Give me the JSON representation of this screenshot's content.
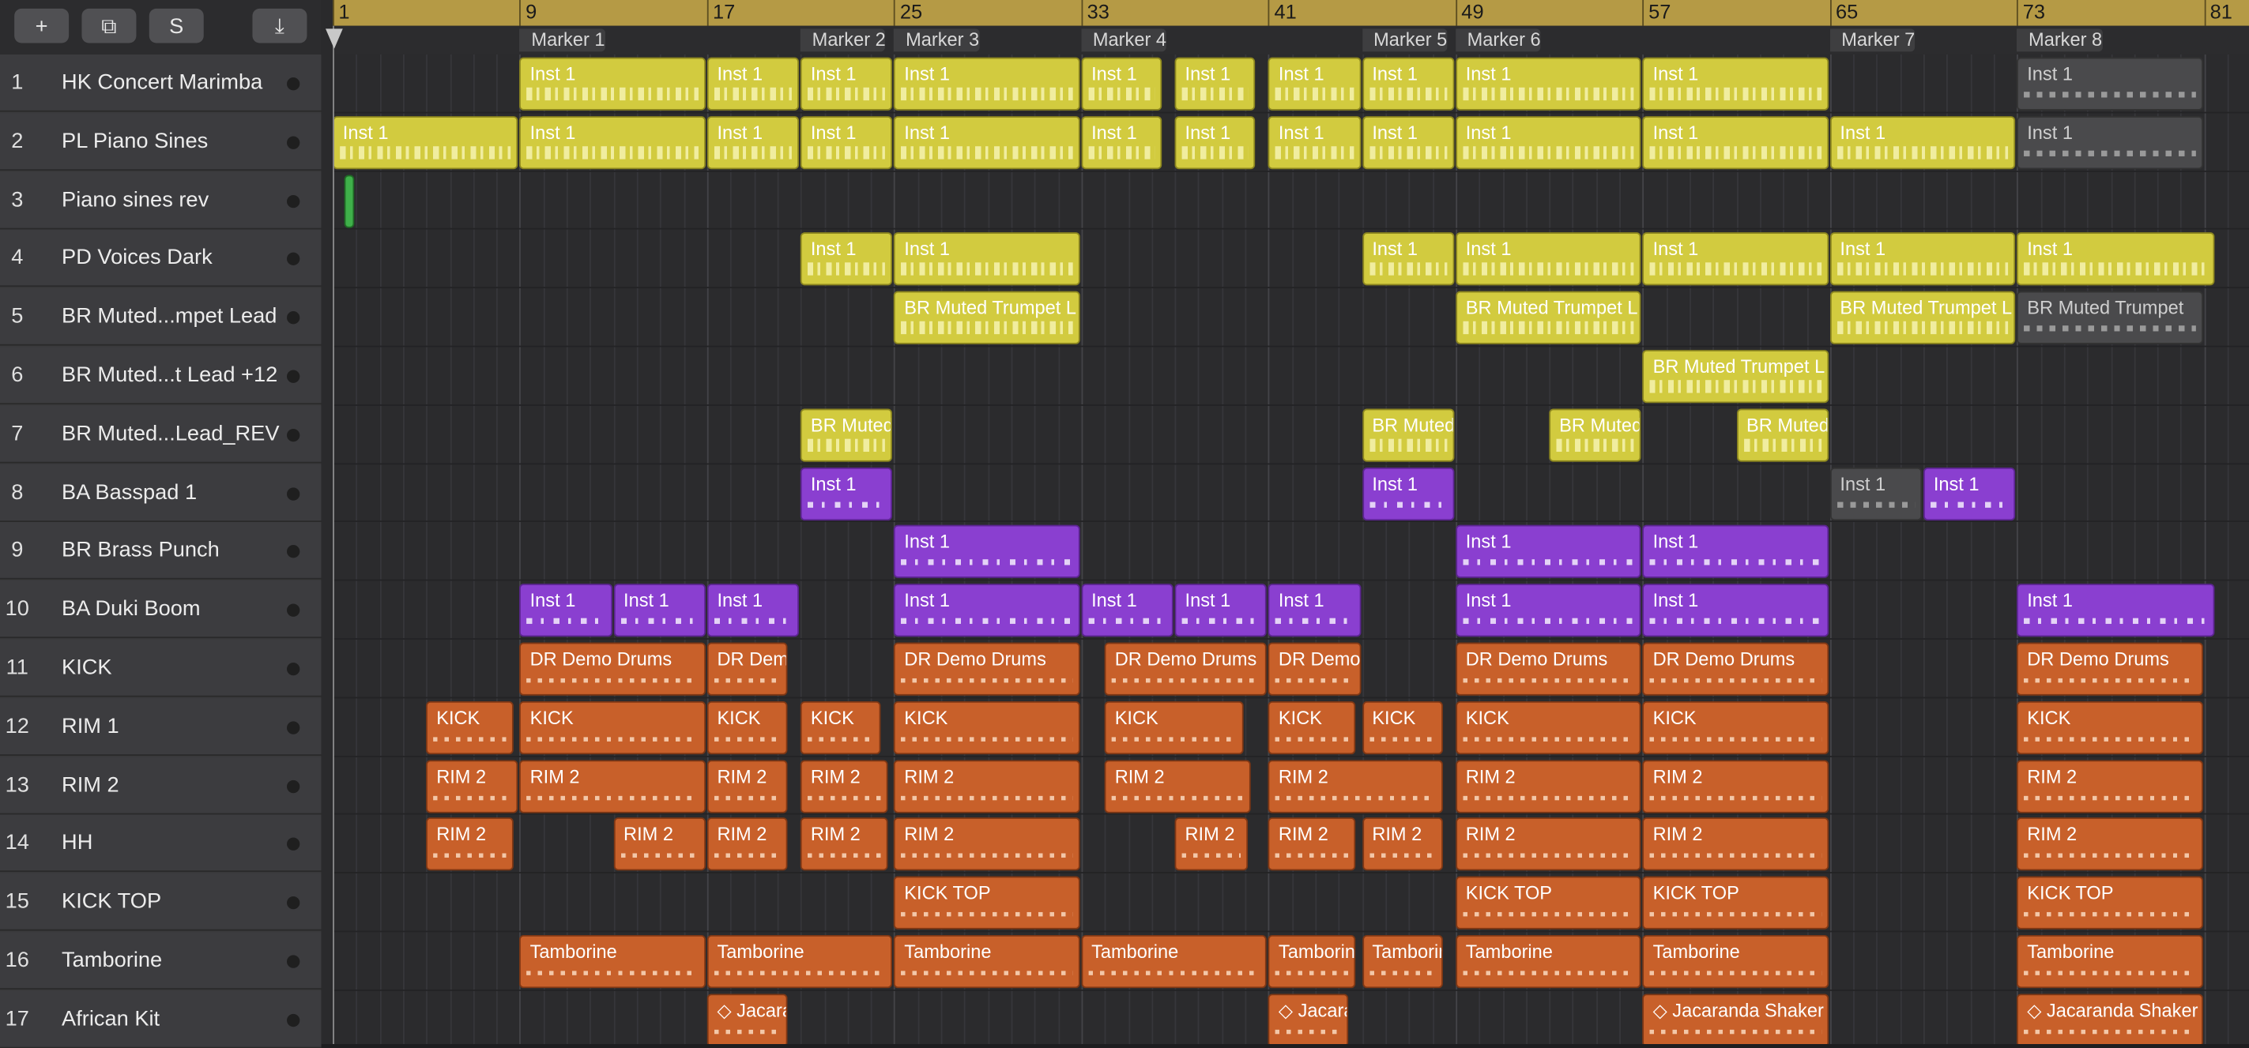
{
  "toolbar": {
    "add_label": "+",
    "duplicate_label": "⧉",
    "s_label": "S",
    "download_label": "⤓"
  },
  "ruler": {
    "bars": [
      "1",
      "9",
      "17",
      "25",
      "33",
      "41",
      "49",
      "57",
      "65",
      "73",
      "81"
    ]
  },
  "markers": [
    "Marker 1",
    "Marker 2",
    "Marker 3",
    "Marker 4",
    "Marker 5",
    "Marker 6",
    "Marker 7",
    "Marker 8"
  ],
  "tracks": [
    {
      "num": "1",
      "name": "HK Concert Marimba"
    },
    {
      "num": "2",
      "name": "PL Piano Sines"
    },
    {
      "num": "3",
      "name": "Piano sines rev"
    },
    {
      "num": "4",
      "name": "PD Voices Dark"
    },
    {
      "num": "5",
      "name": "BR Muted...mpet Lead"
    },
    {
      "num": "6",
      "name": "BR Muted...t Lead +12"
    },
    {
      "num": "7",
      "name": "BR Muted...Lead_REV"
    },
    {
      "num": "8",
      "name": "BA Basspad 1"
    },
    {
      "num": "9",
      "name": "BR Brass Punch"
    },
    {
      "num": "10",
      "name": "BA Duki Boom"
    },
    {
      "num": "11",
      "name": "KICK"
    },
    {
      "num": "12",
      "name": "RIM 1"
    },
    {
      "num": "13",
      "name": "RIM 2"
    },
    {
      "num": "14",
      "name": "HH"
    },
    {
      "num": "15",
      "name": "KICK TOP"
    },
    {
      "num": "16",
      "name": "Tamborine"
    },
    {
      "num": "17",
      "name": "African Kit"
    }
  ],
  "colors": {
    "yellow_region": "#d2cb3f",
    "purple_region": "#8a3fd0",
    "orange_region": "#c8602a",
    "muted_region": "#4a4a4c",
    "ruler": "#b59a45"
  },
  "regions": [
    {
      "track": 1,
      "start": 9,
      "end": 17,
      "label": "Inst 1",
      "kind": "yel"
    },
    {
      "track": 1,
      "start": 17,
      "end": 21,
      "label": "Inst 1",
      "kind": "yel"
    },
    {
      "track": 1,
      "start": 21,
      "end": 25,
      "label": "Inst 1",
      "kind": "yel"
    },
    {
      "track": 1,
      "start": 25,
      "end": 33,
      "label": "Inst 1",
      "kind": "yel"
    },
    {
      "track": 1,
      "start": 33,
      "end": 36.5,
      "label": "Inst 1",
      "kind": "yel"
    },
    {
      "track": 1,
      "start": 37,
      "end": 40.5,
      "label": "Inst 1",
      "kind": "yel"
    },
    {
      "track": 1,
      "start": 41,
      "end": 45,
      "label": "Inst 1",
      "kind": "yel"
    },
    {
      "track": 1,
      "start": 45,
      "end": 49,
      "label": "Inst 1",
      "kind": "yel"
    },
    {
      "track": 1,
      "start": 49,
      "end": 57,
      "label": "Inst 1",
      "kind": "yel"
    },
    {
      "track": 1,
      "start": 57,
      "end": 65,
      "label": "Inst 1",
      "kind": "yel"
    },
    {
      "track": 1,
      "start": 73,
      "end": 81,
      "label": "Inst 1",
      "kind": "dim"
    },
    {
      "track": 2,
      "start": 1,
      "end": 9,
      "label": "Inst 1",
      "kind": "yel"
    },
    {
      "track": 2,
      "start": 9,
      "end": 17,
      "label": "Inst 1",
      "kind": "yel"
    },
    {
      "track": 2,
      "start": 17,
      "end": 21,
      "label": "Inst 1",
      "kind": "yel"
    },
    {
      "track": 2,
      "start": 21,
      "end": 25,
      "label": "Inst 1",
      "kind": "yel"
    },
    {
      "track": 2,
      "start": 25,
      "end": 33,
      "label": "Inst 1",
      "kind": "yel"
    },
    {
      "track": 2,
      "start": 33,
      "end": 36.5,
      "label": "Inst 1",
      "kind": "yel"
    },
    {
      "track": 2,
      "start": 37,
      "end": 40.5,
      "label": "Inst 1",
      "kind": "yel"
    },
    {
      "track": 2,
      "start": 41,
      "end": 45,
      "label": "Inst 1",
      "kind": "yel"
    },
    {
      "track": 2,
      "start": 45,
      "end": 49,
      "label": "Inst 1",
      "kind": "yel"
    },
    {
      "track": 2,
      "start": 49,
      "end": 57,
      "label": "Inst 1",
      "kind": "yel"
    },
    {
      "track": 2,
      "start": 57,
      "end": 65,
      "label": "Inst 1",
      "kind": "yel"
    },
    {
      "track": 2,
      "start": 65,
      "end": 73,
      "label": "Inst 1",
      "kind": "yel"
    },
    {
      "track": 2,
      "start": 73,
      "end": 81,
      "label": "Inst 1",
      "kind": "dim"
    },
    {
      "track": 3,
      "start": 1.5,
      "end": 2,
      "label": "",
      "kind": "green"
    },
    {
      "track": 4,
      "start": 21,
      "end": 25,
      "label": "Inst 1",
      "kind": "yel"
    },
    {
      "track": 4,
      "start": 25,
      "end": 33,
      "label": "Inst 1",
      "kind": "yel"
    },
    {
      "track": 4,
      "start": 45,
      "end": 49,
      "label": "Inst 1",
      "kind": "yel"
    },
    {
      "track": 4,
      "start": 49,
      "end": 57,
      "label": "Inst 1",
      "kind": "yel"
    },
    {
      "track": 4,
      "start": 57,
      "end": 65,
      "label": "Inst 1",
      "kind": "yel"
    },
    {
      "track": 4,
      "start": 65,
      "end": 73,
      "label": "Inst 1",
      "kind": "yel"
    },
    {
      "track": 4,
      "start": 73,
      "end": 81.5,
      "label": "Inst 1",
      "kind": "yel"
    },
    {
      "track": 5,
      "start": 25,
      "end": 33,
      "label": "BR Muted Trumpet L",
      "kind": "yel"
    },
    {
      "track": 5,
      "start": 49,
      "end": 57,
      "label": "BR Muted Trumpet L",
      "kind": "yel"
    },
    {
      "track": 5,
      "start": 65,
      "end": 73,
      "label": "BR Muted Trumpet L",
      "kind": "yel"
    },
    {
      "track": 5,
      "start": 73,
      "end": 81,
      "label": "BR Muted Trumpet",
      "kind": "dim"
    },
    {
      "track": 6,
      "start": 57,
      "end": 65,
      "label": "BR Muted Trumpet L",
      "kind": "yel"
    },
    {
      "track": 7,
      "start": 21,
      "end": 25,
      "label": "BR Muted",
      "kind": "yel"
    },
    {
      "track": 7,
      "start": 45,
      "end": 49,
      "label": "BR Muted",
      "kind": "yel"
    },
    {
      "track": 7,
      "start": 53,
      "end": 57,
      "label": "BR Muted",
      "kind": "yel"
    },
    {
      "track": 7,
      "start": 61,
      "end": 65,
      "label": "BR Muted",
      "kind": "yel"
    },
    {
      "track": 8,
      "start": 21,
      "end": 25,
      "label": "Inst 1",
      "kind": "pur"
    },
    {
      "track": 8,
      "start": 45,
      "end": 49,
      "label": "Inst 1",
      "kind": "pur"
    },
    {
      "track": 8,
      "start": 65,
      "end": 69,
      "label": "Inst 1",
      "kind": "dim"
    },
    {
      "track": 8,
      "start": 69,
      "end": 73,
      "label": "Inst 1",
      "kind": "pur"
    },
    {
      "track": 9,
      "start": 25,
      "end": 33,
      "label": "Inst 1",
      "kind": "pur"
    },
    {
      "track": 9,
      "start": 49,
      "end": 57,
      "label": "Inst 1",
      "kind": "pur"
    },
    {
      "track": 9,
      "start": 57,
      "end": 65,
      "label": "Inst 1",
      "kind": "pur"
    },
    {
      "track": 10,
      "start": 9,
      "end": 13,
      "label": "Inst 1",
      "kind": "pur"
    },
    {
      "track": 10,
      "start": 13,
      "end": 17,
      "label": "Inst 1",
      "kind": "pur"
    },
    {
      "track": 10,
      "start": 17,
      "end": 21,
      "label": "Inst 1",
      "kind": "pur"
    },
    {
      "track": 10,
      "start": 25,
      "end": 33,
      "label": "Inst 1",
      "kind": "pur"
    },
    {
      "track": 10,
      "start": 33,
      "end": 37,
      "label": "Inst 1",
      "kind": "pur"
    },
    {
      "track": 10,
      "start": 37,
      "end": 41,
      "label": "Inst 1",
      "kind": "pur"
    },
    {
      "track": 10,
      "start": 41,
      "end": 45,
      "label": "Inst 1",
      "kind": "pur"
    },
    {
      "track": 10,
      "start": 49,
      "end": 57,
      "label": "Inst 1",
      "kind": "pur"
    },
    {
      "track": 10,
      "start": 57,
      "end": 65,
      "label": "Inst 1",
      "kind": "pur"
    },
    {
      "track": 10,
      "start": 73,
      "end": 81.5,
      "label": "Inst 1",
      "kind": "pur"
    },
    {
      "track": 11,
      "start": 9,
      "end": 17,
      "label": "DR Demo Drums",
      "kind": "org"
    },
    {
      "track": 11,
      "start": 17,
      "end": 20.5,
      "label": "DR Dem",
      "kind": "org"
    },
    {
      "track": 11,
      "start": 25,
      "end": 33,
      "label": "DR Demo Drums",
      "kind": "org"
    },
    {
      "track": 11,
      "start": 34,
      "end": 41,
      "label": "DR Demo Drums",
      "kind": "org"
    },
    {
      "track": 11,
      "start": 41,
      "end": 45,
      "label": "DR Demo",
      "kind": "org"
    },
    {
      "track": 11,
      "start": 49,
      "end": 57,
      "label": "DR Demo Drums",
      "kind": "org"
    },
    {
      "track": 11,
      "start": 57,
      "end": 65,
      "label": "DR Demo Drums",
      "kind": "org"
    },
    {
      "track": 11,
      "start": 73,
      "end": 81,
      "label": "DR Demo Drums",
      "kind": "org"
    },
    {
      "track": 12,
      "start": 5,
      "end": 8.8,
      "label": "KICK",
      "kind": "org"
    },
    {
      "track": 12,
      "start": 9,
      "end": 17,
      "label": "KICK",
      "kind": "org"
    },
    {
      "track": 12,
      "start": 17,
      "end": 20.5,
      "label": "KICK",
      "kind": "org"
    },
    {
      "track": 12,
      "start": 21,
      "end": 24.5,
      "label": "KICK",
      "kind": "org"
    },
    {
      "track": 12,
      "start": 25,
      "end": 33,
      "label": "KICK",
      "kind": "org"
    },
    {
      "track": 12,
      "start": 34,
      "end": 40,
      "label": "KICK",
      "kind": "org"
    },
    {
      "track": 12,
      "start": 41,
      "end": 44.8,
      "label": "KICK",
      "kind": "org"
    },
    {
      "track": 12,
      "start": 45,
      "end": 48.5,
      "label": "KICK",
      "kind": "org"
    },
    {
      "track": 12,
      "start": 49,
      "end": 57,
      "label": "KICK",
      "kind": "org"
    },
    {
      "track": 12,
      "start": 57,
      "end": 65,
      "label": "KICK",
      "kind": "org"
    },
    {
      "track": 12,
      "start": 73,
      "end": 81,
      "label": "KICK",
      "kind": "org"
    },
    {
      "track": 13,
      "start": 5,
      "end": 9,
      "label": "RIM 2",
      "kind": "org"
    },
    {
      "track": 13,
      "start": 9,
      "end": 17,
      "label": "RIM 2",
      "kind": "org"
    },
    {
      "track": 13,
      "start": 17,
      "end": 20.5,
      "label": "RIM 2",
      "kind": "org"
    },
    {
      "track": 13,
      "start": 21,
      "end": 24.8,
      "label": "RIM 2",
      "kind": "org"
    },
    {
      "track": 13,
      "start": 25,
      "end": 33,
      "label": "RIM 2",
      "kind": "org"
    },
    {
      "track": 13,
      "start": 34,
      "end": 40.3,
      "label": "RIM 2",
      "kind": "org"
    },
    {
      "track": 13,
      "start": 41,
      "end": 48.5,
      "label": "RIM 2",
      "kind": "org"
    },
    {
      "track": 13,
      "start": 49,
      "end": 57,
      "label": "RIM 2",
      "kind": "org"
    },
    {
      "track": 13,
      "start": 57,
      "end": 65,
      "label": "RIM 2",
      "kind": "org"
    },
    {
      "track": 13,
      "start": 73,
      "end": 81,
      "label": "RIM 2",
      "kind": "org"
    },
    {
      "track": 14,
      "start": 5,
      "end": 8.8,
      "label": "RIM 2",
      "kind": "org"
    },
    {
      "track": 14,
      "start": 13,
      "end": 17,
      "label": "RIM 2",
      "kind": "org"
    },
    {
      "track": 14,
      "start": 17,
      "end": 20.5,
      "label": "RIM 2",
      "kind": "org"
    },
    {
      "track": 14,
      "start": 21,
      "end": 24.8,
      "label": "RIM 2",
      "kind": "org"
    },
    {
      "track": 14,
      "start": 25,
      "end": 33,
      "label": "RIM 2",
      "kind": "org"
    },
    {
      "track": 14,
      "start": 37,
      "end": 40.2,
      "label": "RIM 2",
      "kind": "org"
    },
    {
      "track": 14,
      "start": 41,
      "end": 44.8,
      "label": "RIM 2",
      "kind": "org"
    },
    {
      "track": 14,
      "start": 45,
      "end": 48.5,
      "label": "RIM 2",
      "kind": "org"
    },
    {
      "track": 14,
      "start": 49,
      "end": 57,
      "label": "RIM 2",
      "kind": "org"
    },
    {
      "track": 14,
      "start": 57,
      "end": 65,
      "label": "RIM 2",
      "kind": "org"
    },
    {
      "track": 14,
      "start": 73,
      "end": 81,
      "label": "RIM 2",
      "kind": "org"
    },
    {
      "track": 15,
      "start": 25,
      "end": 33,
      "label": "KICK TOP",
      "kind": "org"
    },
    {
      "track": 15,
      "start": 49,
      "end": 57,
      "label": "KICK TOP",
      "kind": "org"
    },
    {
      "track": 15,
      "start": 57,
      "end": 65,
      "label": "KICK TOP",
      "kind": "org"
    },
    {
      "track": 15,
      "start": 73,
      "end": 81,
      "label": "KICK TOP",
      "kind": "org"
    },
    {
      "track": 16,
      "start": 9,
      "end": 17,
      "label": "Tamborine",
      "kind": "org"
    },
    {
      "track": 16,
      "start": 17,
      "end": 25,
      "label": "Tamborine",
      "kind": "org"
    },
    {
      "track": 16,
      "start": 25,
      "end": 33,
      "label": "Tamborine",
      "kind": "org"
    },
    {
      "track": 16,
      "start": 33,
      "end": 41,
      "label": "Tamborine",
      "kind": "org"
    },
    {
      "track": 16,
      "start": 41,
      "end": 44.8,
      "label": "Tamborin",
      "kind": "org"
    },
    {
      "track": 16,
      "start": 45,
      "end": 48.5,
      "label": "Tamborin",
      "kind": "org"
    },
    {
      "track": 16,
      "start": 49,
      "end": 57,
      "label": "Tamborine",
      "kind": "org"
    },
    {
      "track": 16,
      "start": 57,
      "end": 65,
      "label": "Tamborine",
      "kind": "org"
    },
    {
      "track": 16,
      "start": 73,
      "end": 81,
      "label": "Tamborine",
      "kind": "org"
    },
    {
      "track": 17,
      "start": 17,
      "end": 20.5,
      "label": "◇ Jacara",
      "kind": "org"
    },
    {
      "track": 17,
      "start": 41,
      "end": 44.5,
      "label": "◇ Jacara",
      "kind": "org"
    },
    {
      "track": 17,
      "start": 57,
      "end": 65,
      "label": "◇ Jacaranda Shaker",
      "kind": "org"
    },
    {
      "track": 17,
      "start": 73,
      "end": 81,
      "label": "◇ Jacaranda Shaker",
      "kind": "org"
    }
  ]
}
